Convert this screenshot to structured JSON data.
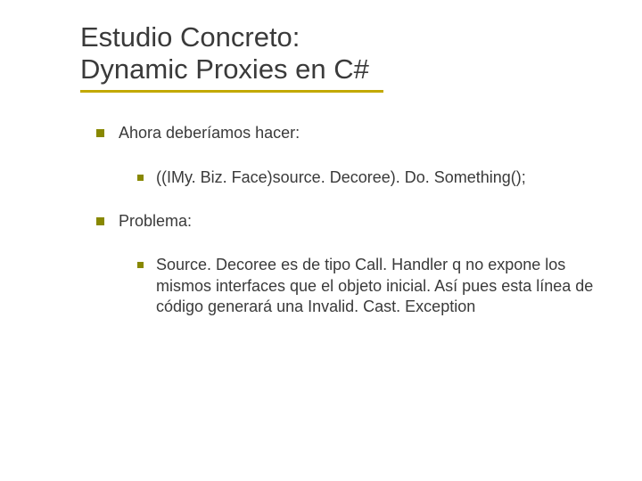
{
  "title_line1": "Estudio Concreto:",
  "title_line2": "Dynamic Proxies en C#",
  "items": [
    {
      "level": 1,
      "text": "Ahora deberíamos hacer:"
    },
    {
      "level": 2,
      "text": "((IMy. Biz. Face)source. Decoree). Do. Something();"
    },
    {
      "level": 1,
      "text": "Problema:"
    },
    {
      "level": 2,
      "text": "Source. Decoree es de tipo Call. Handler q no expone los mismos interfaces que el objeto inicial. Así pues esta línea de código generará una Invalid. Cast. Exception"
    }
  ]
}
